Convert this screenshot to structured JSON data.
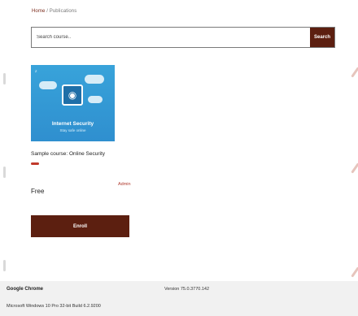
{
  "breadcrumb": {
    "home": "Home",
    "separator": "/",
    "current": "Publications"
  },
  "search": {
    "placeholder": "Search course..",
    "button_label": "Search"
  },
  "course": {
    "image": {
      "tag": "Z",
      "title": "Internet Security",
      "subtitle": "Stay safe online"
    },
    "name": "Sample course: Online Security",
    "author": "Admin",
    "price": "Free",
    "enroll_label": "Enroll"
  },
  "footer": {
    "app": "Google Chrome",
    "version": "Version 75.0.3770.142",
    "os": "Microsoft Windows 10 Pro 32-bit Build 6.2.9200"
  },
  "colors": {
    "accent": "#5c1f10",
    "accent_bar": "#c0392b",
    "link": "#7a2a1a",
    "image_bg": "#38a3da"
  },
  "icons": {
    "device": "wifi-device-icon"
  }
}
